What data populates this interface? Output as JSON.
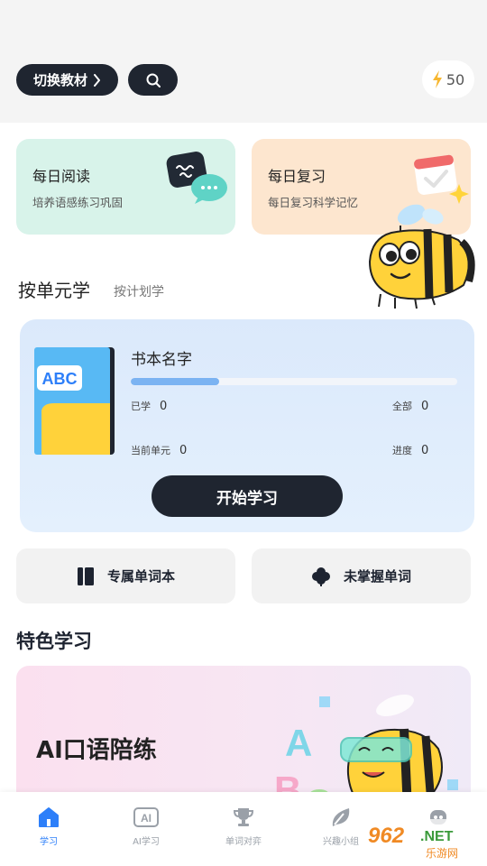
{
  "header": {
    "switch_label": "切换教材",
    "energy_value": "50"
  },
  "cards": {
    "read": {
      "title": "每日阅读",
      "subtitle": "培养语感练习巩固"
    },
    "review": {
      "title": "每日复习",
      "subtitle": "每日复习科学记忆"
    }
  },
  "mode_tabs": {
    "unit": "按单元学",
    "plan": "按计划学"
  },
  "book": {
    "cover_text": "ABC",
    "name": "书本名字",
    "progress_fraction": 0.27,
    "learned_label": "已学",
    "learned_value": "0",
    "total_label": "全部",
    "total_value": "0",
    "unit_label": "当前单元",
    "unit_value": "0",
    "progress_label": "进度",
    "progress_value": "0",
    "start_label": "开始学习"
  },
  "shortcuts": {
    "vocab": "专属单词本",
    "unmastered": "未掌握单词"
  },
  "features": {
    "section_title": "特色学习",
    "ai_speaking": "AI口语陪练"
  },
  "tabbar": [
    {
      "label": "学习",
      "icon": "home-icon",
      "active": true
    },
    {
      "label": "AI学习",
      "icon": "ai-icon",
      "active": false
    },
    {
      "label": "单词对弈",
      "icon": "trophy-icon",
      "active": false
    },
    {
      "label": "兴趣小组",
      "icon": "leaf-icon",
      "active": false
    },
    {
      "label": "",
      "icon": "robot-icon",
      "active": false
    }
  ],
  "watermark": {
    "top": "962",
    "suffix": ".NET",
    "bottom": "乐游网"
  },
  "colors": {
    "dark": "#1f2530",
    "accent_blue": "#2d7ff9",
    "progress_blue": "#7bb3f2",
    "energy_yellow": "#f7b731"
  }
}
